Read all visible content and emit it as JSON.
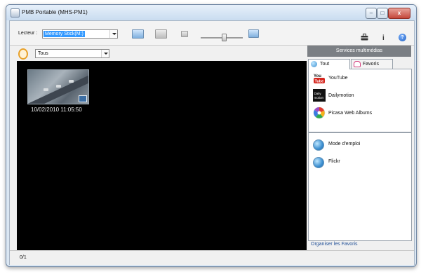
{
  "window": {
    "title": "PMB Portable (MHS-PM1)",
    "controls": {
      "minimize": "–",
      "maximize": "□",
      "close": "x"
    }
  },
  "toolbar": {
    "reader_label": "Lecteur :",
    "reader_value": "Memory Stick(M:)",
    "icons": [
      "import-icon",
      "export-icon",
      "small-thumbnail-icon",
      "zoom-slider",
      "large-thumbnail-icon",
      "toolbox-icon",
      "info-icon",
      "help-icon"
    ],
    "info_glyph": "i",
    "help_glyph": "?"
  },
  "filter": {
    "value": "Tous"
  },
  "thumbnails": [
    {
      "date": "10/02/2010 11:05:50"
    }
  ],
  "services": {
    "header": "Services multimédias",
    "tabs": [
      {
        "label": "Tout",
        "active": true
      },
      {
        "label": "Favoris",
        "active": false
      }
    ],
    "items": [
      {
        "label": "YouTube",
        "icon": "youtube-icon"
      },
      {
        "label": "Dailymotion",
        "icon": "dailymotion-icon"
      },
      {
        "label": "Picasa Web Albums",
        "icon": "picasa-icon"
      }
    ],
    "links": [
      {
        "label": "Mode d'emploi",
        "icon": "globe-icon"
      },
      {
        "label": "Flickr",
        "icon": "globe-icon"
      }
    ],
    "organize_label": "Organiser les Favoris"
  },
  "status": {
    "count": "0/1"
  },
  "colors": {
    "selection": "#3399ff",
    "panel_header": "#7b7f84",
    "preview_bg": "#000000"
  }
}
